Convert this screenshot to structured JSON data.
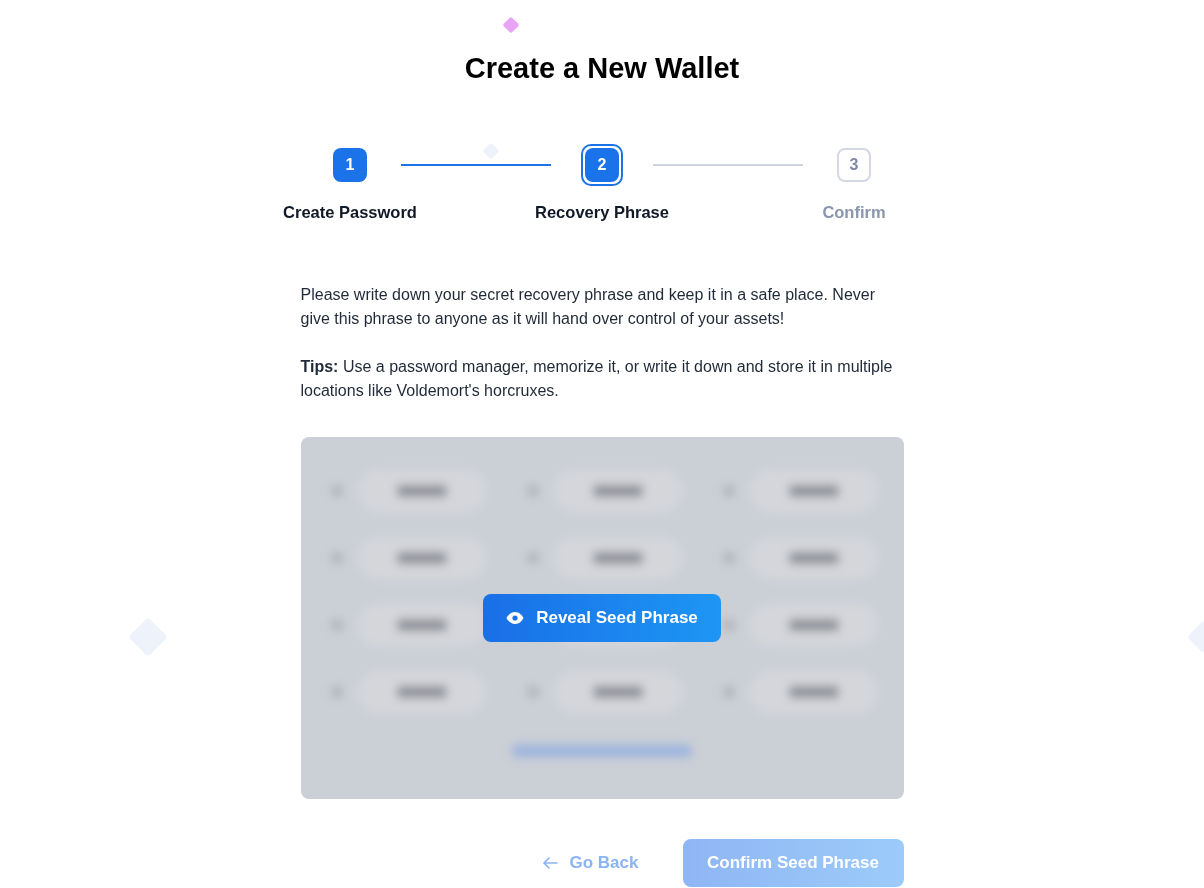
{
  "title": "Create a New Wallet",
  "steps": [
    {
      "number": "1",
      "label": "Create Password",
      "completed": true,
      "selected": false
    },
    {
      "number": "2",
      "label": "Recovery Phrase",
      "completed": false,
      "selected": true
    },
    {
      "number": "3",
      "label": "Confirm",
      "completed": false,
      "selected": false
    }
  ],
  "paragraphs": [
    "Please write down your secret recovery phrase and keep it in a safe place. Never give this phrase to anyone as it will hand over control of your assets!",
    "**Tips:** Use a password manager, memorize it, or write it down and store it in multiple locations like Voldemort's horcruxes."
  ],
  "phrase_panel": {
    "revealed": false,
    "reveal_button": "Reveal Seed Phrase"
  },
  "footer": {
    "back_button": "Go Back",
    "confirm_button": {
      "label": "Confirm Seed Phrase",
      "disabled": true
    }
  }
}
